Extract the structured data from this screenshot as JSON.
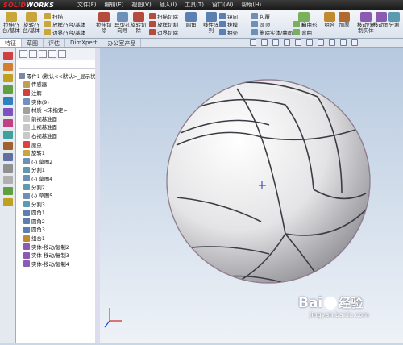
{
  "app": {
    "logo_a": "SOLID",
    "logo_b": "WORKS"
  },
  "menus": [
    "文件(F)",
    "编辑(E)",
    "视图(V)",
    "插入(I)",
    "工具(T)",
    "窗口(W)",
    "帮助(H)"
  ],
  "ribbon": {
    "big": [
      {
        "l1": "拉伸凸",
        "l2": "台/基体",
        "c": "#c9a63a"
      },
      {
        "l1": "旋转凸",
        "l2": "台/基体",
        "c": "#c9a63a"
      },
      {
        "l1": "拉伸切",
        "l2": "除",
        "c": "#b54a3e"
      },
      {
        "l1": "异型孔",
        "l2": "向导",
        "c": "#6e8fb8"
      },
      {
        "l1": "旋转切",
        "l2": "除",
        "c": "#b54a3e"
      },
      {
        "l1": "圆角",
        "l2": "",
        "c": "#5b7fb0"
      },
      {
        "l1": "线性阵",
        "l2": "列",
        "c": "#5b7fb0"
      },
      {
        "l1": "筋",
        "l2": "",
        "c": "#7ab05b"
      },
      {
        "l1": "组合",
        "l2": "",
        "c": "#c08a30"
      },
      {
        "l1": "加厚",
        "l2": "",
        "c": "#b06a30"
      },
      {
        "l1": "移动/复",
        "l2": "制实体",
        "c": "#8a5bb0"
      },
      {
        "l1": "移动面",
        "l2": "",
        "c": "#8a5bb0"
      },
      {
        "l1": "分割",
        "l2": "",
        "c": "#5b9ab0"
      }
    ],
    "small": [
      "扫描",
      "放样凸台/基体",
      "边界凸台/基体",
      "扫描切除",
      "放样切割",
      "边界切除",
      "镜向",
      "拔模",
      "抽壳",
      "包覆",
      "圆顶",
      "删除实体/曲面",
      "自由形",
      "弯曲"
    ]
  },
  "tabs": [
    "特征",
    "草图",
    "评估",
    "DimXpert",
    "办公室产品"
  ],
  "tree": [
    "零件1 (默认<<默认>_显示状态",
    "传感器",
    "注解",
    "实体(9)",
    "材质 <未指定>",
    "前视基准面",
    "上视基准面",
    "右视基准面",
    "原点",
    "旋转1",
    "(-) 草图2",
    "分割1",
    "(-) 草图4",
    "分割2",
    "(-) 草图5",
    "分割3",
    "圆角1",
    "圆角2",
    "圆角3",
    "组合1",
    "实体-移动/复制2",
    "实体-移动/复制3",
    "实体-移动/复制4"
  ],
  "watermark": {
    "brand": "Bai",
    "brand2": "经验",
    "url": "jingyan.baidu.com"
  },
  "icons": {
    "ball": "volleyball-model",
    "triad": "axis-triad"
  }
}
